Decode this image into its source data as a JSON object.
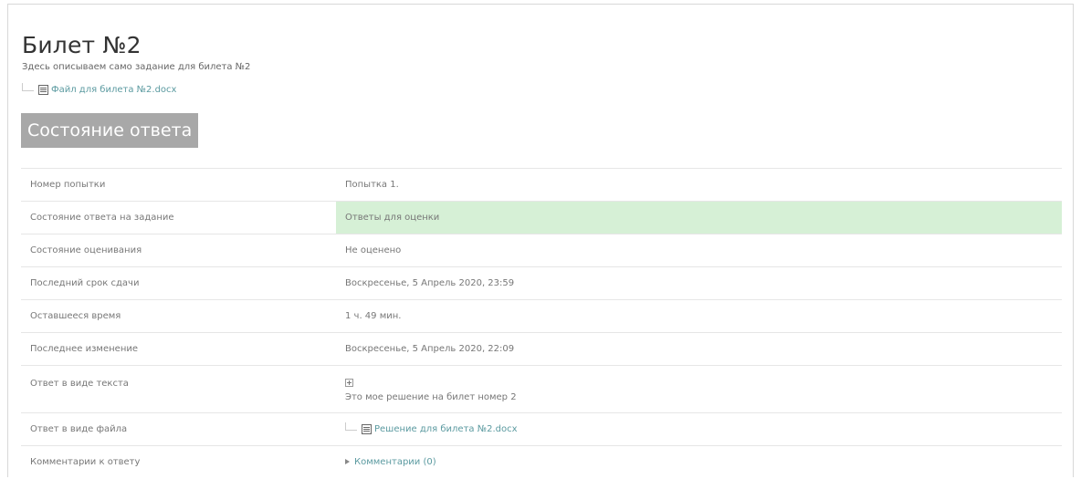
{
  "page": {
    "title": "Билет №2",
    "description": "Здесь описываем само задание для билета №2",
    "attachment": {
      "name": "Файл для билета №2.docx",
      "icon": "docx-file-icon"
    },
    "status_heading": "Состояние ответа"
  },
  "summary": {
    "rows": [
      {
        "label": "Номер попытки",
        "value": "Попытка 1."
      },
      {
        "label": "Состояние ответа на задание",
        "value": "Ответы для оценки",
        "highlight": true,
        "highlight_color": "#d6f0d6"
      },
      {
        "label": "Состояние оценивания",
        "value": "Не оценено"
      },
      {
        "label": "Последний срок сдачи",
        "value": "Воскресенье, 5 Апрель 2020, 23:59"
      },
      {
        "label": "Оставшееся время",
        "value": "1 ч. 49 мин."
      },
      {
        "label": "Последнее изменение",
        "value": "Воскресенье, 5 Апрель 2020, 22:09"
      },
      {
        "label": "Ответ в виде текста",
        "value": "Это мое решение на билет номер 2",
        "icon": "expand-plus-icon"
      },
      {
        "label": "Ответ в виде файла",
        "value": "Решение для билета №2.docx",
        "icon": "docx-file-icon"
      },
      {
        "label": "Комментарии к ответу",
        "value": "Комментарии (0)",
        "icon": "collapsed-triangle-icon"
      }
    ]
  }
}
